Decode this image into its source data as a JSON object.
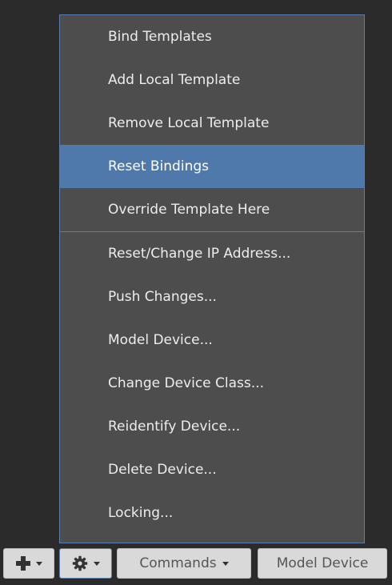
{
  "menu": {
    "items_top": [
      {
        "label": "Bind Templates"
      },
      {
        "label": "Add Local Template"
      },
      {
        "label": "Remove Local Template"
      },
      {
        "label": "Reset Bindings",
        "active": true
      },
      {
        "label": "Override Template Here"
      }
    ],
    "items_bottom": [
      {
        "label": "Reset/Change IP Address..."
      },
      {
        "label": "Push Changes..."
      },
      {
        "label": "Model Device..."
      },
      {
        "label": "Change Device Class..."
      },
      {
        "label": "Reidentify Device..."
      },
      {
        "label": "Delete Device..."
      },
      {
        "label": "Locking..."
      }
    ]
  },
  "toolbar": {
    "add_icon": "plus-icon",
    "settings_icon": "gear-icon",
    "commands_label": "Commands",
    "model_device_label": "Model Device"
  },
  "colors": {
    "background": "#2b2b2b",
    "menu_bg": "#4d4d4d",
    "highlight": "#4f79aa",
    "border": "#5b7fab"
  }
}
